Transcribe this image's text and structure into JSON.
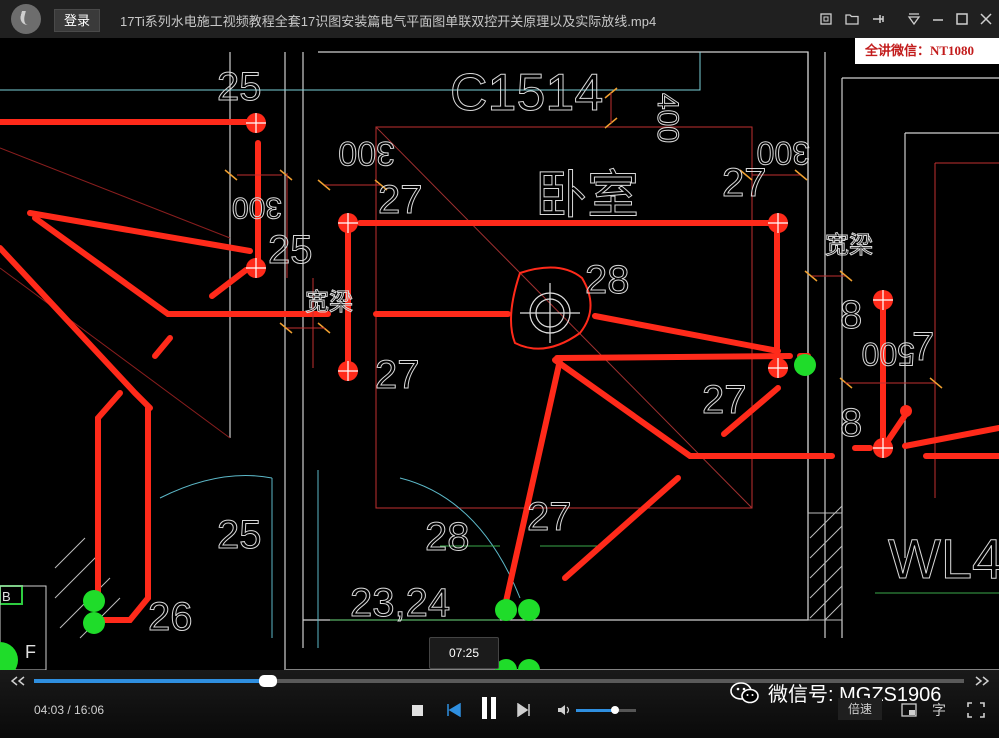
{
  "titlebar": {
    "login_label": "登录",
    "title": "17Ti系列水电施工视频教程全套17识图安装篇电气平面图单联双控开关原理以及实际放线.mp4"
  },
  "watermark": {
    "text": "全讲微信：NT1080"
  },
  "cad": {
    "labels": [
      "25",
      "C1514",
      "400",
      "300",
      "27",
      "卧室",
      "27",
      "300",
      "300",
      "25",
      "28",
      "宽梁",
      "宽梁",
      "8",
      "27",
      "500",
      "7",
      "27",
      "8",
      "25",
      "28",
      "27",
      "WL4",
      "23,24",
      "26",
      "F",
      "B"
    ]
  },
  "player": {
    "tooltip_time": "07:25",
    "current_time": "04:03",
    "separator": " / ",
    "total_time": "16:06",
    "progress_fraction": 0.252,
    "volume_fraction": 0.65,
    "speed_label": "倍速",
    "subtitle_label": "字",
    "wechat_text": "微信号: MGZS1906"
  },
  "colors": {
    "accent": "#2f8fe0",
    "wire": "#ff2a1a",
    "node": "#1fdc2a"
  }
}
